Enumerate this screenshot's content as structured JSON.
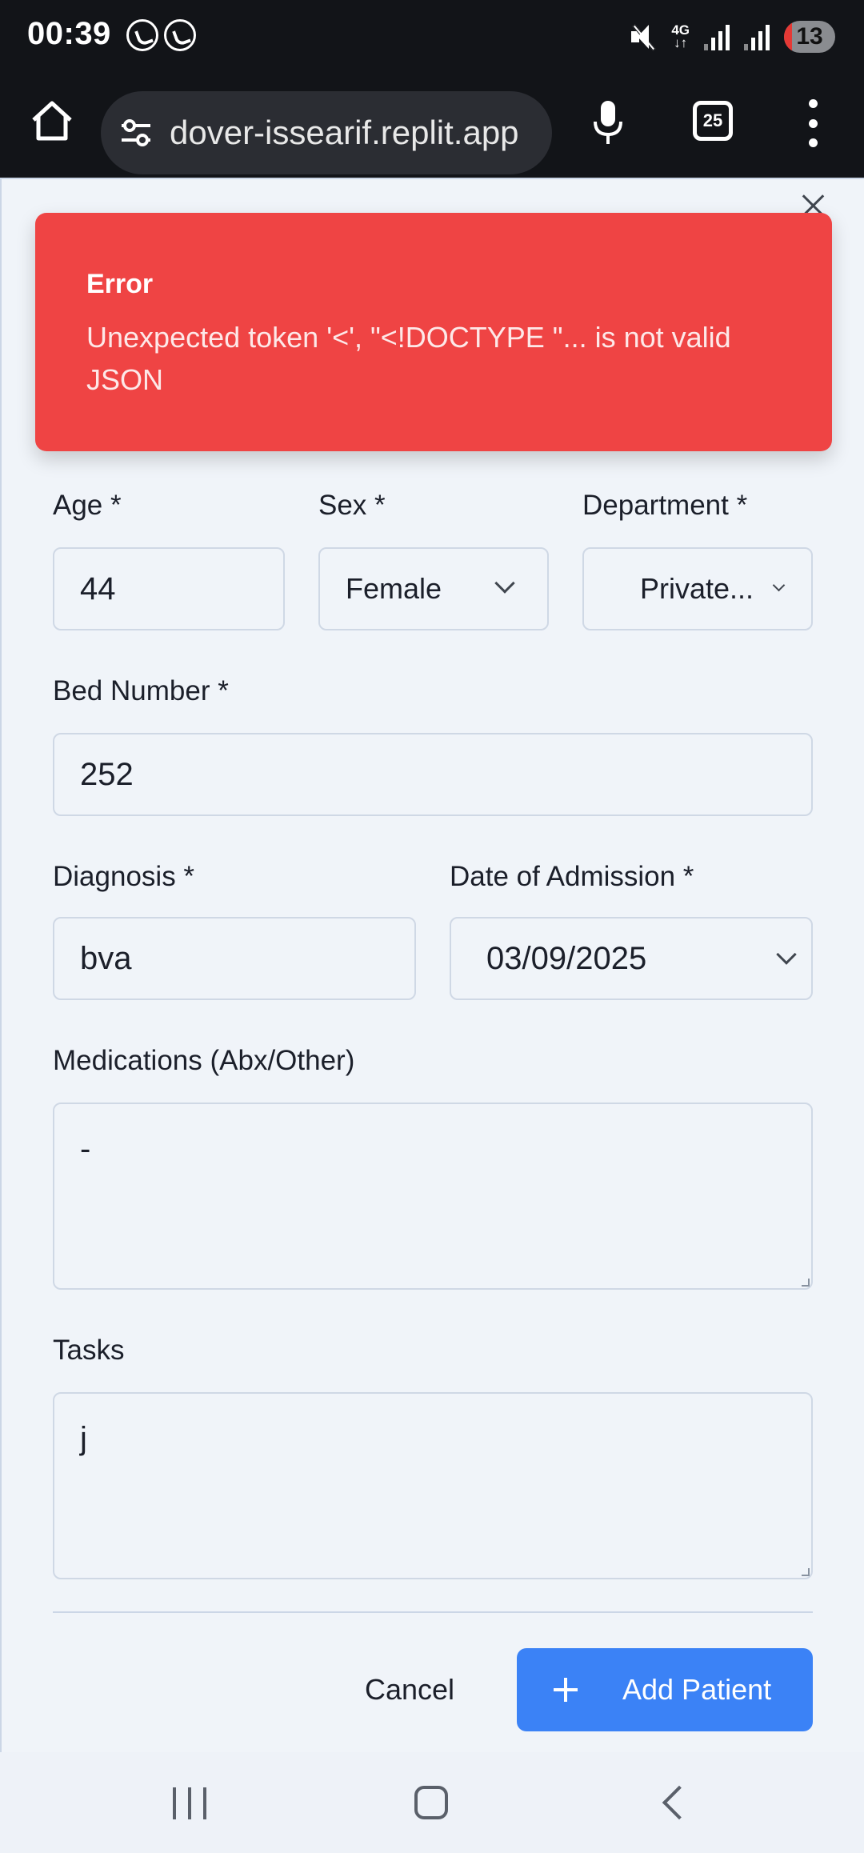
{
  "status_bar": {
    "time": "00:39",
    "network_label": "4G",
    "notification_count": "13"
  },
  "browser": {
    "url": "dover-issearif.replit.app",
    "tab_count": "25"
  },
  "toast": {
    "title": "Error",
    "message": "Unexpected token '<', \"<!DOCTYPE \"... is not valid JSON",
    "color": "#ef4444"
  },
  "form": {
    "age": {
      "label": "Age *",
      "value": "44"
    },
    "sex": {
      "label": "Sex *",
      "value": "Female"
    },
    "department": {
      "label": "Department *",
      "value": "Private..."
    },
    "bed_number": {
      "label": "Bed Number *",
      "value": "252"
    },
    "diagnosis": {
      "label": "Diagnosis *",
      "value": "bva"
    },
    "date_of_admission": {
      "label": "Date of Admission *",
      "value": "03/09/2025"
    },
    "medications": {
      "label": "Medications (Abx/Other)",
      "value": "-"
    },
    "tasks": {
      "label": "Tasks",
      "value": "j"
    }
  },
  "actions": {
    "cancel_label": "Cancel",
    "add_label": "Add Patient",
    "add_color": "#3b82f6"
  },
  "icons": [
    "viber-icon",
    "mute-icon",
    "signal-icon",
    "home-icon",
    "tune-icon",
    "mic-icon",
    "tabs-icon",
    "more-menu-icon",
    "close-icon",
    "chevron-down-icon",
    "plus-icon",
    "recents-icon",
    "home-button-icon",
    "back-icon"
  ]
}
